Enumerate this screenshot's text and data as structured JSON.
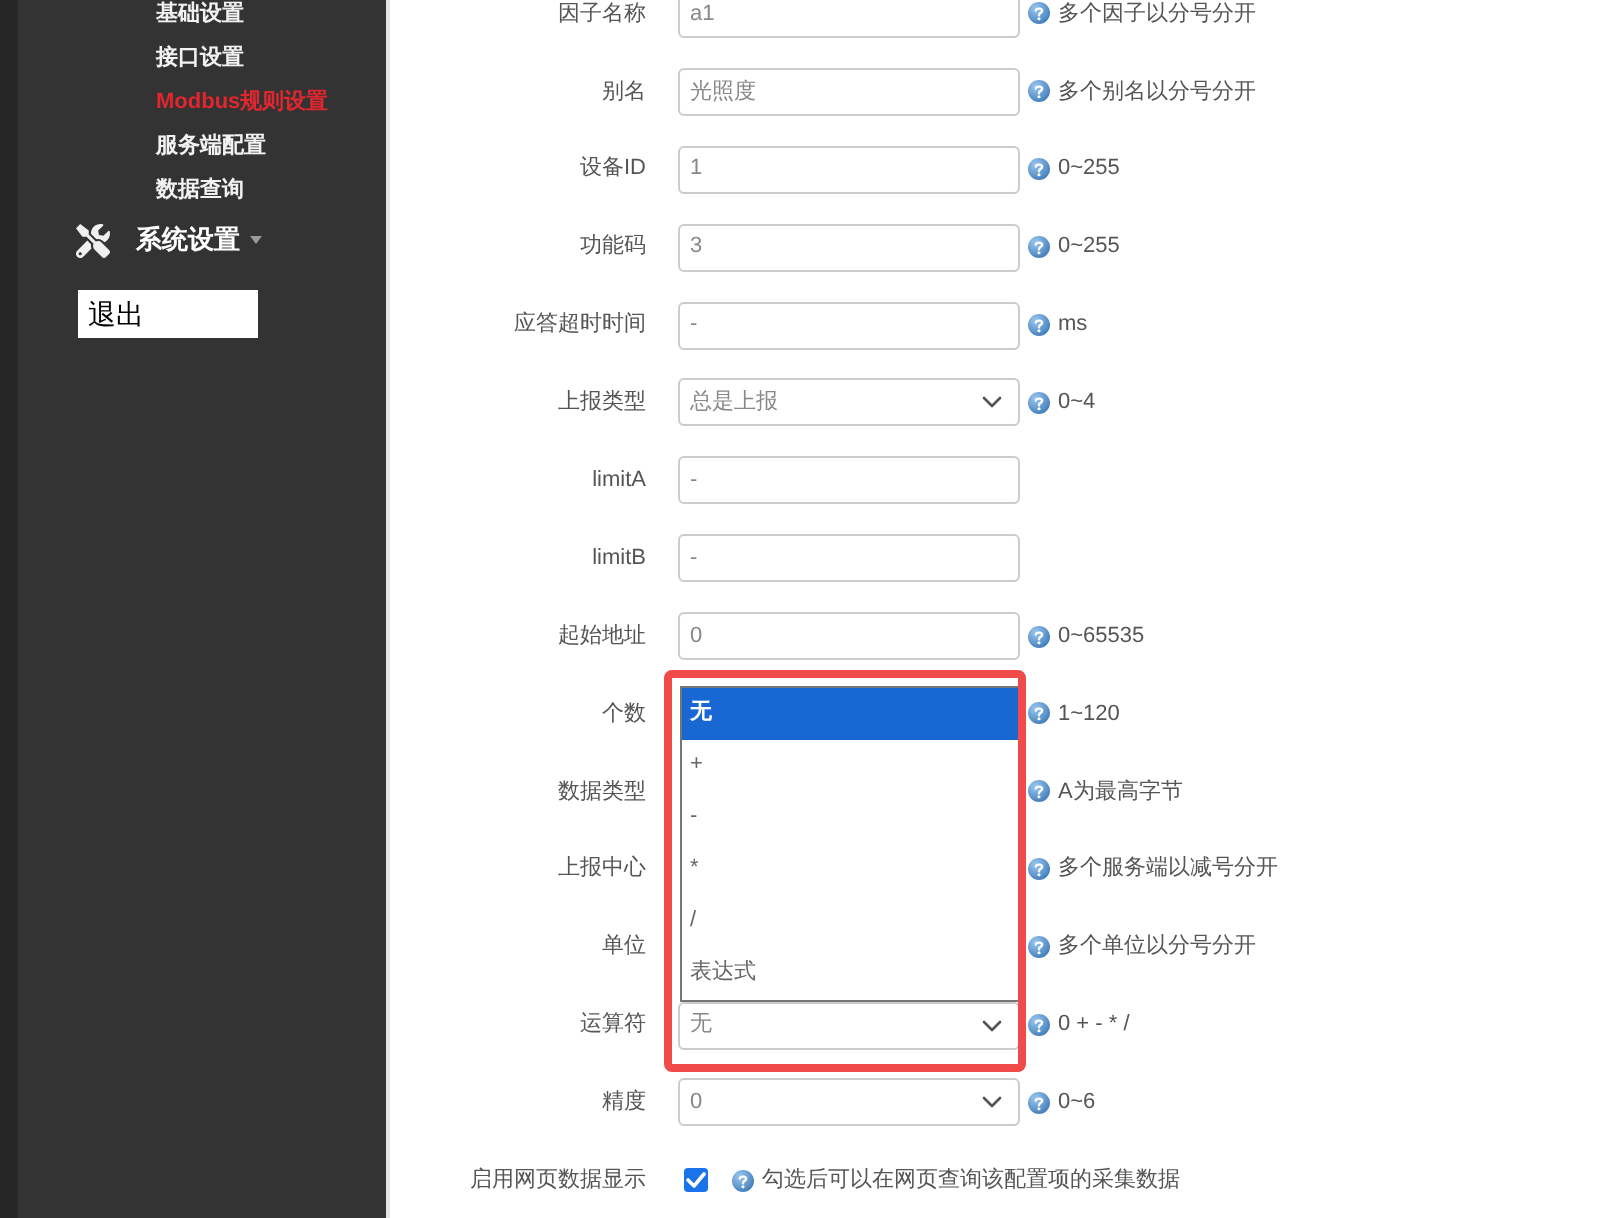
{
  "sidebar": {
    "items": [
      {
        "label": "基础设置",
        "selected": false
      },
      {
        "label": "接口设置",
        "selected": false
      },
      {
        "label": "Modbus规则设置",
        "selected": true
      },
      {
        "label": "服务端配置",
        "selected": false
      },
      {
        "label": "数据查询",
        "selected": false
      }
    ],
    "section": {
      "label": "系统设置"
    },
    "logout": {
      "label": "退出"
    }
  },
  "form": {
    "fields": [
      {
        "label": "因子名称",
        "kind": "input",
        "value": "a1",
        "help": "多个因子以分号分开"
      },
      {
        "label": "别名",
        "kind": "input",
        "value": "光照度",
        "help": "多个别名以分号分开"
      },
      {
        "label": "设备ID",
        "kind": "input",
        "value": "1",
        "help": "0~255"
      },
      {
        "label": "功能码",
        "kind": "input",
        "value": "3",
        "help": "0~255"
      },
      {
        "label": "应答超时时间",
        "kind": "input",
        "value": "-",
        "help": "ms"
      },
      {
        "label": "上报类型",
        "kind": "select",
        "value": "总是上报",
        "help": "0~4"
      },
      {
        "label": "limitA",
        "kind": "input",
        "value": "-"
      },
      {
        "label": "limitB",
        "kind": "input",
        "value": "-"
      },
      {
        "label": "起始地址",
        "kind": "input",
        "value": "0",
        "help": "0~65535"
      },
      {
        "label": "个数",
        "kind": "covered",
        "help": "1~120"
      },
      {
        "label": "数据类型",
        "kind": "covered",
        "help": "A为最高字节"
      },
      {
        "label": "上报中心",
        "kind": "covered",
        "help": "多个服务端以减号分开"
      },
      {
        "label": "单位",
        "kind": "covered",
        "help": "多个单位以分号分开"
      },
      {
        "label": "运算符",
        "kind": "select",
        "value": "无",
        "help": "0 + - * /",
        "expanded": true,
        "highlighted": true,
        "options": [
          {
            "label": "无",
            "selected": true
          },
          {
            "label": "+",
            "selected": false
          },
          {
            "label": "-",
            "selected": false
          },
          {
            "label": "*",
            "selected": false
          },
          {
            "label": "/",
            "selected": false
          },
          {
            "label": "表达式",
            "selected": false
          }
        ]
      },
      {
        "label": "精度",
        "kind": "select",
        "value": "0",
        "help": "0~6"
      },
      {
        "label": "启用网页数据显示",
        "kind": "checkbox",
        "checked": true,
        "help": "勾选后可以在网页查询该配置项的采集数据"
      }
    ]
  }
}
